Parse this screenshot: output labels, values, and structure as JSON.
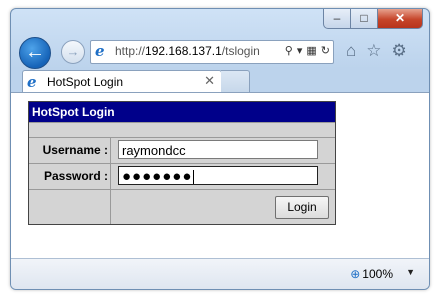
{
  "window": {
    "caption_buttons": {
      "minimize": "–",
      "maximize": "□",
      "close": "✕"
    }
  },
  "nav": {
    "back_icon": "back-arrow-icon",
    "forward_icon": "forward-arrow-icon",
    "address": {
      "scheme": "http://",
      "host": "192.168.137.1",
      "path": "/tslogin"
    },
    "address_tools": {
      "search": "⚲",
      "dropdown": "▾",
      "compat": "▦",
      "refresh": "↻"
    },
    "toolbar_icons": {
      "home": "⌂",
      "favorites": "☆",
      "settings": "⚙"
    }
  },
  "tab": {
    "title": "HotSpot Login",
    "close": "✕"
  },
  "login": {
    "heading": "HotSpot Login",
    "username_label": "Username :",
    "username_value": "raymondcc",
    "password_label": "Password :",
    "password_mask": "●●●●●●●",
    "button_label": "Login"
  },
  "status": {
    "zoom": "100%",
    "zoom_dropdown": "▼"
  },
  "colors": {
    "header_bg": "#00008a",
    "table_bg": "#d4d4d4",
    "accent": "#1563b8"
  }
}
